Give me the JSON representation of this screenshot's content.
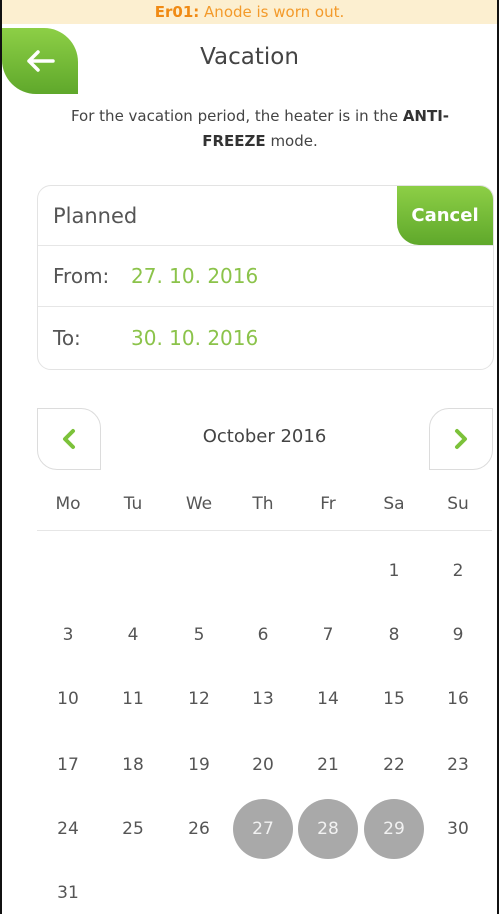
{
  "error": {
    "code": "Er01:",
    "message": " Anode is worn out."
  },
  "header": {
    "title": "Vacation"
  },
  "description": {
    "part1": "For the vacation period, the heater is in the ",
    "mode": "ANTI-FREEZE",
    "part2": " mode."
  },
  "vacation": {
    "status": "Planned",
    "cancel_label": "Cancel",
    "from_label": "From:",
    "from_value": "27. 10. 2016",
    "to_label": "To:",
    "to_value": "30. 10. 2016"
  },
  "calendar": {
    "month_label": "October 2016",
    "weekdays": [
      "Mo",
      "Tu",
      "We",
      "Th",
      "Fr",
      "Sa",
      "Su"
    ],
    "weeks": [
      [
        "",
        "",
        "",
        "",
        "",
        "1",
        "2"
      ],
      [
        "3",
        "4",
        "5",
        "6",
        "7",
        "8",
        "9"
      ],
      [
        "10",
        "11",
        "12",
        "13",
        "14",
        "15",
        "16"
      ],
      [
        "17",
        "18",
        "19",
        "20",
        "21",
        "22",
        "23"
      ],
      [
        "24",
        "25",
        "26",
        "27",
        "28",
        "29",
        "30"
      ],
      [
        "31",
        "",
        "",
        "",
        "",
        "",
        ""
      ]
    ],
    "selected_days": [
      "27",
      "28",
      "29"
    ]
  },
  "colors": {
    "accent_green": "#7cc23a",
    "value_green": "#8bc34a",
    "error_orange": "#f39a2a",
    "selected_gray": "#a9a9a9"
  },
  "icons": {
    "back": "arrow-left-icon",
    "prev": "chevron-left-icon",
    "next": "chevron-right-icon"
  }
}
